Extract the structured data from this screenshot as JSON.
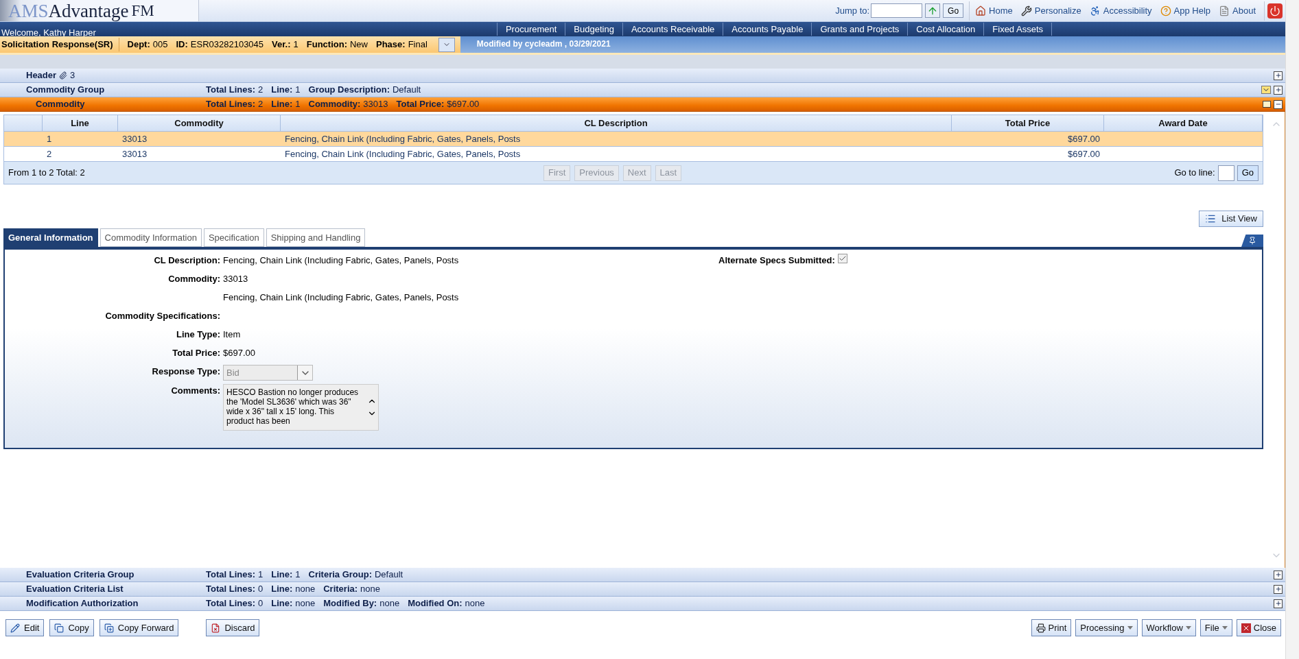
{
  "app": {
    "logo_prefix": "AMS",
    "logo_name": "Advantage",
    "logo_suffix": "FM"
  },
  "top_links": {
    "jump_label": "Jump to:",
    "go": "Go",
    "links": [
      {
        "label": "Home",
        "kind": "home"
      },
      {
        "label": "Personalize",
        "kind": "wrench"
      },
      {
        "label": "Accessibility",
        "kind": "access"
      },
      {
        "label": "App Help",
        "kind": "help"
      },
      {
        "label": "About",
        "kind": "about"
      }
    ]
  },
  "welcome": "Welcome, Kathy Harper",
  "menu": [
    "Procurement",
    "Budgeting",
    "Accounts Receivable",
    "Accounts Payable",
    "Grants and Projects",
    "Cost Allocation",
    "Fixed Assets"
  ],
  "document": {
    "title": "Solicitation Response(SR)",
    "fields": [
      {
        "label": "Dept:",
        "value": "005"
      },
      {
        "label": "ID:",
        "value": "ESR03282103045"
      },
      {
        "label": "Ver.:",
        "value": "1"
      },
      {
        "label": "Function:",
        "value": "New"
      },
      {
        "label": "Phase:",
        "value": "Final"
      }
    ],
    "modified": "Modified by cycleadm , 03/29/2021"
  },
  "sections_top": [
    {
      "title": "Header",
      "attachments": "3",
      "selected": false,
      "expanded": false
    },
    {
      "title": "Commodity Group",
      "selected": false,
      "expanded": false,
      "fields": [
        {
          "label": "Total Lines:",
          "value": "2"
        },
        {
          "label": "Line:",
          "value": "1"
        },
        {
          "label": "Group Description:",
          "value": "Default"
        }
      ]
    },
    {
      "title": "Commodity",
      "selected": true,
      "expanded": true,
      "fields": [
        {
          "label": "Total Lines:",
          "value": "2"
        },
        {
          "label": "Line:",
          "value": "1"
        },
        {
          "label": "Commodity:",
          "value": "33013"
        },
        {
          "label": "Total Price:",
          "value": "$697.00"
        }
      ]
    }
  ],
  "table": {
    "columns": [
      "Line",
      "Commodity",
      "CL Description",
      "Total Price",
      "Award Date"
    ],
    "rows": [
      {
        "line": "1",
        "commodity": "33013",
        "description": "Fencing, Chain Link (Including Fabric, Gates, Panels, Posts",
        "total_price": "$697.00",
        "selected": true
      },
      {
        "line": "2",
        "commodity": "33013",
        "description": "Fencing, Chain Link (Including Fabric, Gates, Panels, Posts",
        "total_price": "$697.00",
        "selected": false
      }
    ],
    "summary": "From 1 to 2 Total: 2",
    "pager": [
      {
        "label": "First",
        "disabled": true
      },
      {
        "label": "Previous",
        "disabled": true
      },
      {
        "label": "Next",
        "disabled": true
      },
      {
        "label": "Last",
        "disabled": true
      }
    ],
    "goto_label": "Go to line:",
    "go": "Go"
  },
  "list_view": "List View",
  "tabs": [
    {
      "label": "General Information",
      "selected": true
    },
    {
      "label": "Commodity Information",
      "selected": false
    },
    {
      "label": "Specification",
      "selected": false
    },
    {
      "label": "Shipping and Handling",
      "selected": false
    }
  ],
  "form": [
    {
      "kind": "text",
      "label": "CL Description:",
      "value": "Fencing, Chain Link (Including Fabric, Gates, Panels, Posts"
    },
    {
      "kind": "text",
      "label": "Commodity:",
      "value": "33013"
    },
    {
      "kind": "text",
      "value": "Fencing, Chain Link (Including Fabric, Gates, Panels, Posts"
    },
    {
      "kind": "text",
      "label": "Commodity Specifications:"
    },
    {
      "kind": "text",
      "label": "Line Type:",
      "value": "Item"
    },
    {
      "kind": "text",
      "label": "Total Price:",
      "value": "$697.00"
    },
    {
      "kind": "select",
      "label": "Response Type:",
      "value": "Bid",
      "disabled": true
    },
    {
      "kind": "textarea",
      "label": "Comments:",
      "value": "HESCO Bastion no longer produces the 'Model SL3636' which was 36\" wide x 36\" tall x 15' long.  This product has been"
    }
  ],
  "alternate": {
    "label": "Alternate Specs Submitted:",
    "checked": true
  },
  "sections_bottom": [
    {
      "title": "Evaluation Criteria Group",
      "selected": false,
      "expanded": false,
      "fields": [
        {
          "label": "Total Lines:",
          "value": "1"
        },
        {
          "label": "Line:",
          "value": "1"
        },
        {
          "label": "Criteria Group:",
          "value": "Default"
        }
      ]
    },
    {
      "title": "Evaluation Criteria List",
      "selected": false,
      "expanded": false,
      "fields": [
        {
          "label": "Total Lines:",
          "value": "0"
        },
        {
          "label": "Line:",
          "value": "none"
        },
        {
          "label": "Criteria:",
          "value": "none"
        }
      ]
    },
    {
      "title": "Modification Authorization",
      "selected": false,
      "expanded": false,
      "fields": [
        {
          "label": "Total Lines:",
          "value": "0"
        },
        {
          "label": "Line:",
          "value": "none"
        },
        {
          "label": "Modified By:",
          "value": "none"
        },
        {
          "label": "Modified On:",
          "value": "none"
        }
      ]
    }
  ],
  "actions_left": [
    {
      "label": "Edit",
      "kind": "edit"
    },
    {
      "label": "Copy",
      "kind": "copy"
    },
    {
      "label": "Copy Forward",
      "kind": "forward"
    },
    {
      "label": "Discard",
      "kind": "discard"
    }
  ],
  "actions_right": [
    {
      "label": "Print",
      "kind": "print"
    },
    {
      "label": "Processing",
      "kind": "dropdown"
    },
    {
      "label": "Workflow",
      "kind": "dropdown"
    },
    {
      "label": "File",
      "kind": "dropdown"
    },
    {
      "label": "Close",
      "kind": "close"
    }
  ]
}
